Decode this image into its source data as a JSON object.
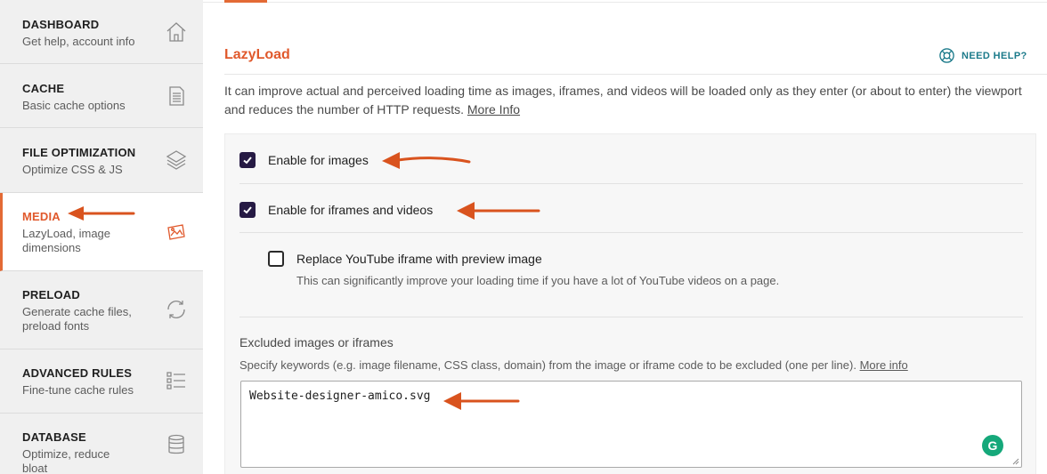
{
  "sidebar": {
    "items": [
      {
        "title": "DASHBOARD",
        "desc": "Get help, account info",
        "icon": "home-icon"
      },
      {
        "title": "CACHE",
        "desc": "Basic cache options",
        "icon": "document-icon"
      },
      {
        "title": "FILE OPTIMIZATION",
        "desc": "Optimize CSS & JS",
        "icon": "layers-icon"
      },
      {
        "title": "MEDIA",
        "desc": "LazyLoad, image dimensions",
        "icon": "images-icon",
        "active": true
      },
      {
        "title": "PRELOAD",
        "desc": "Generate cache files, preload fonts",
        "icon": "refresh-icon"
      },
      {
        "title": "ADVANCED RULES",
        "desc": "Fine-tune cache rules",
        "icon": "list-icon"
      },
      {
        "title": "DATABASE",
        "desc": "Optimize, reduce bloat",
        "icon": "database-icon"
      }
    ]
  },
  "main": {
    "section_title": "LazyLoad",
    "help_label": "NEED HELP?",
    "intro_text": "It can improve actual and perceived loading time as images, iframes, and videos will be loaded only as they enter (or about to enter) the viewport and reduces the number of HTTP requests.",
    "intro_link": "More Info",
    "options": {
      "images": {
        "label": "Enable for images",
        "checked": true
      },
      "iframes": {
        "label": "Enable for iframes and videos",
        "checked": true
      },
      "youtube": {
        "label": "Replace YouTube iframe with preview image",
        "checked": false,
        "desc": "This can significantly improve your loading time if you have a lot of YouTube videos on a page."
      }
    },
    "excluded": {
      "label": "Excluded images or iframes",
      "desc": "Specify keywords (e.g. image filename, CSS class, domain) from the image or iframe code to be excluded (one per line).",
      "link": "More info",
      "value": "Website-designer-amico.svg"
    },
    "grammarly_letter": "G"
  },
  "colors": {
    "accent": "#e0592c",
    "checkbox": "#261a44",
    "help": "#1b7a8a",
    "arrow": "#d9531e"
  }
}
